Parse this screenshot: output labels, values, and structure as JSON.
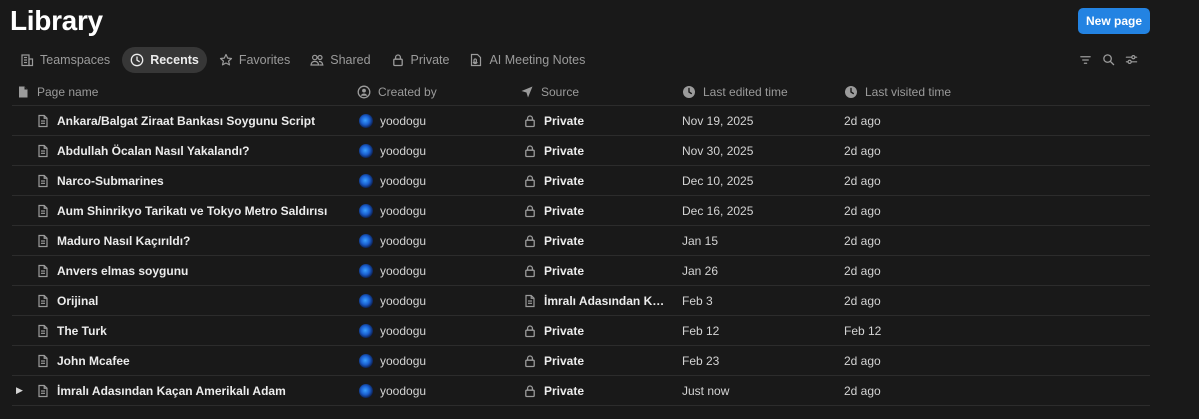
{
  "header": {
    "title": "Library",
    "new_page_label": "New page"
  },
  "tabs": [
    {
      "label": "Teamspaces",
      "icon": "building-icon",
      "active": false
    },
    {
      "label": "Recents",
      "icon": "clock-icon",
      "active": true
    },
    {
      "label": "Favorites",
      "icon": "star-icon",
      "active": false
    },
    {
      "label": "Shared",
      "icon": "people-icon",
      "active": false
    },
    {
      "label": "Private",
      "icon": "lock-icon",
      "active": false
    },
    {
      "label": "AI Meeting Notes",
      "icon": "meeting-notes-icon",
      "active": false
    }
  ],
  "toolbar": {
    "icons": [
      "filter-icon",
      "search-icon",
      "sliders-icon"
    ]
  },
  "columns": {
    "name": "Page name",
    "created_by": "Created by",
    "source": "Source",
    "last_edited": "Last edited time",
    "last_visited": "Last visited time"
  },
  "rows": [
    {
      "name": "Ankara/Balgat Ziraat Bankası Soygunu Script",
      "created_by": "yoodogu",
      "source": "Private",
      "source_icon": "lock-icon",
      "last_edited": "Nov 19, 2025",
      "last_visited": "2d ago",
      "expandable": false
    },
    {
      "name": "Abdullah Öcalan Nasıl Yakalandı?",
      "created_by": "yoodogu",
      "source": "Private",
      "source_icon": "lock-icon",
      "last_edited": "Nov 30, 2025",
      "last_visited": "2d ago",
      "expandable": false
    },
    {
      "name": "Narco-Submarines",
      "created_by": "yoodogu",
      "source": "Private",
      "source_icon": "lock-icon",
      "last_edited": "Dec 10, 2025",
      "last_visited": "2d ago",
      "expandable": false
    },
    {
      "name": "Aum Shinrikyo Tarikatı ve Tokyo Metro Saldırısı",
      "created_by": "yoodogu",
      "source": "Private",
      "source_icon": "lock-icon",
      "last_edited": "Dec 16, 2025",
      "last_visited": "2d ago",
      "expandable": false
    },
    {
      "name": "Maduro Nasıl Kaçırıldı?",
      "created_by": "yoodogu",
      "source": "Private",
      "source_icon": "lock-icon",
      "last_edited": "Jan 15",
      "last_visited": "2d ago",
      "expandable": false
    },
    {
      "name": "Anvers elmas soygunu",
      "created_by": "yoodogu",
      "source": "Private",
      "source_icon": "lock-icon",
      "last_edited": "Jan 26",
      "last_visited": "2d ago",
      "expandable": false
    },
    {
      "name": "Orijinal",
      "created_by": "yoodogu",
      "source": "İmralı Adasından Kaçan Amerikalı Adam",
      "source_icon": "page-icon",
      "last_edited": "Feb 3",
      "last_visited": "2d ago",
      "expandable": false
    },
    {
      "name": "The Turk",
      "created_by": "yoodogu",
      "source": "Private",
      "source_icon": "lock-icon",
      "last_edited": "Feb 12",
      "last_visited": "Feb 12",
      "expandable": false
    },
    {
      "name": "John Mcafee",
      "created_by": "yoodogu",
      "source": "Private",
      "source_icon": "lock-icon",
      "last_edited": "Feb 23",
      "last_visited": "2d ago",
      "expandable": false
    },
    {
      "name": "İmralı Adasından Kaçan Amerikalı Adam",
      "created_by": "yoodogu",
      "source": "Private",
      "source_icon": "lock-icon",
      "last_edited": "Just now",
      "last_visited": "2d ago",
      "expandable": true
    }
  ]
}
